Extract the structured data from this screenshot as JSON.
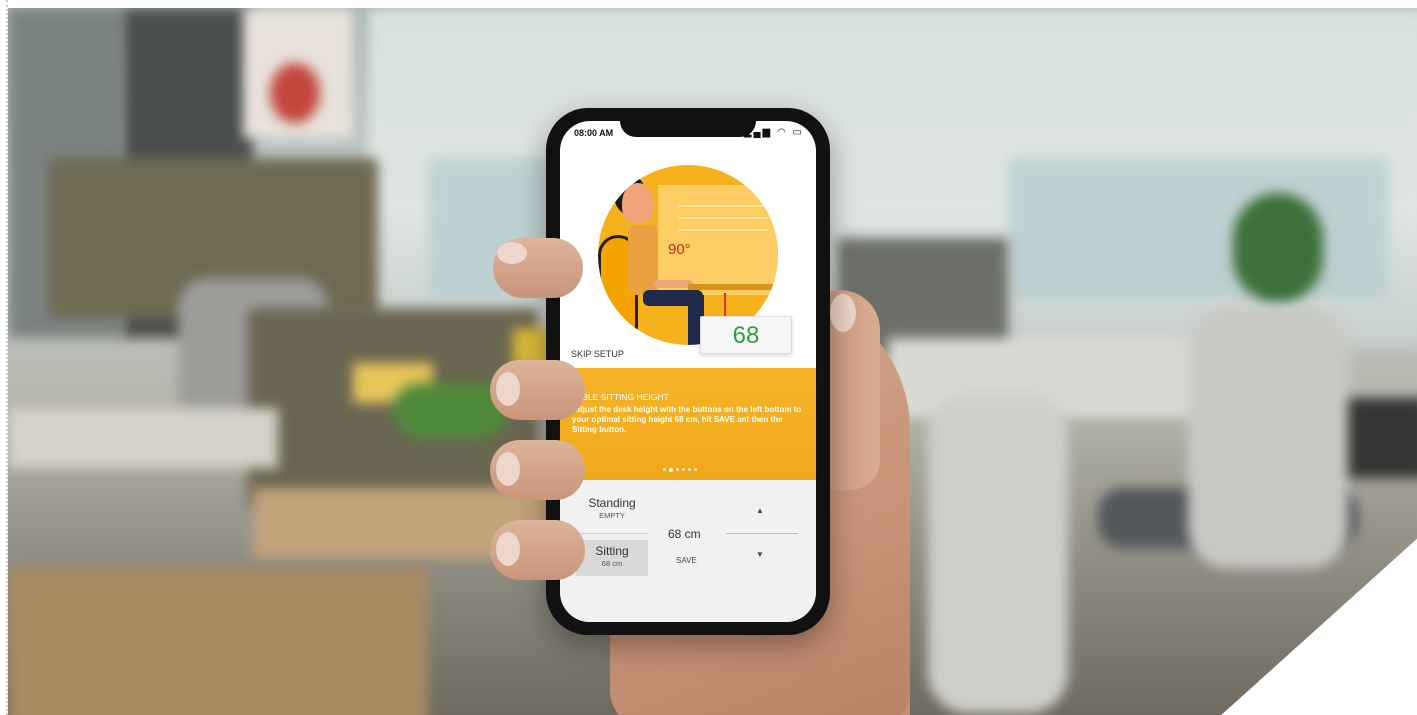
{
  "status_bar": {
    "time": "08:00 AM",
    "icons": "signal wifi battery"
  },
  "illustration": {
    "angle_label": "90°",
    "height_display": "68"
  },
  "skip_setup": "SKIP SETUP",
  "info": {
    "title": "TABLE SITTING HEIGHT",
    "body": "Adjust the desk height with the buttons on the left bottom to your optimal sitting height 68 cm, hit SAVE ant then the Sitting button.",
    "page_dots": 6,
    "active_dot": 1
  },
  "controls": {
    "standing": {
      "label": "Standing",
      "value": "EMPTY"
    },
    "sitting": {
      "label": "Sitting",
      "value": "68 cm"
    },
    "current_height": "68 cm",
    "save_label": "SAVE",
    "up_glyph": "▲",
    "down_glyph": "▼"
  },
  "colors": {
    "accent": "#f6b21c",
    "value_green": "#2e9e3e",
    "angle_red": "#c62828"
  }
}
